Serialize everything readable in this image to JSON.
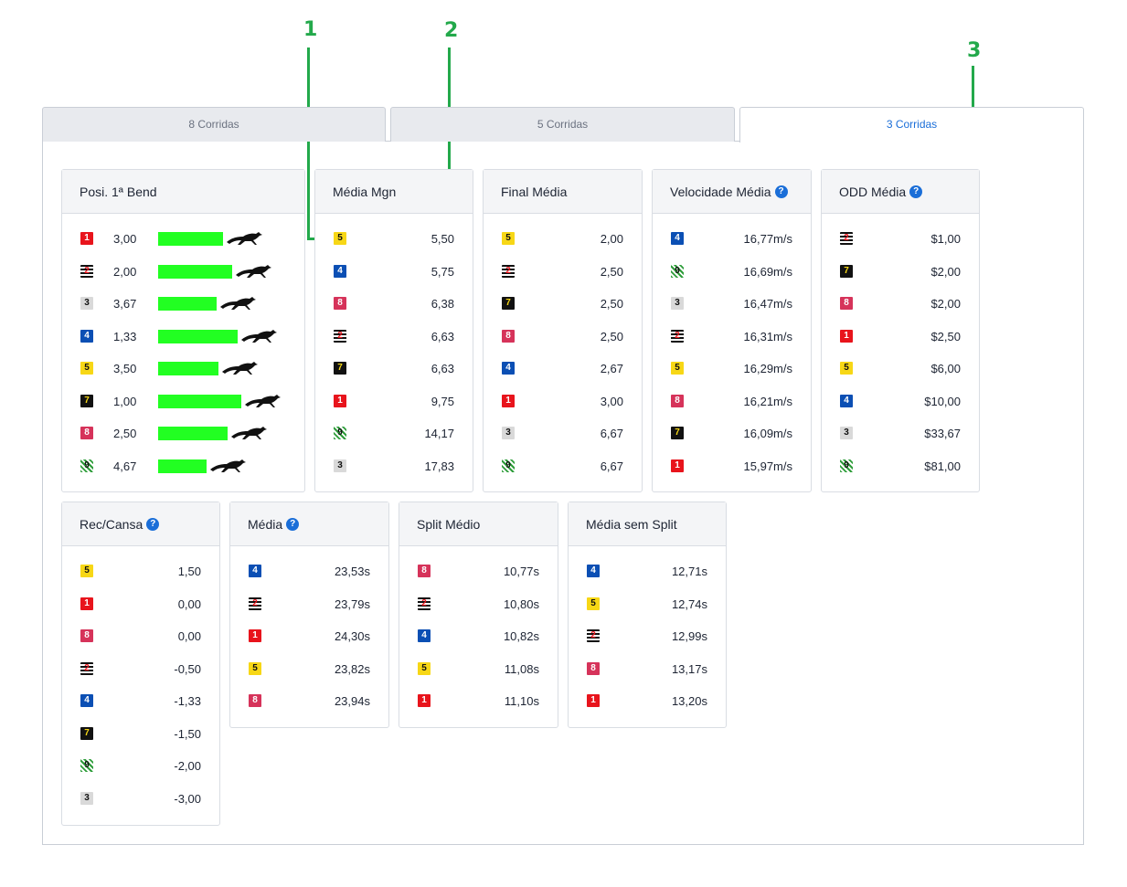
{
  "annotations": [
    "1",
    "2",
    "3"
  ],
  "tabs": [
    {
      "label": "8 Corridas"
    },
    {
      "label": "5 Corridas"
    },
    {
      "label": "3 Corridas",
      "active": true
    }
  ],
  "trap_colors": {
    "1": "#e8141c",
    "2": "#111111",
    "3": "#d9d9d9",
    "4": "#0b4fb4",
    "5": "#f7d716",
    "7": "#111111",
    "8": "#d6335a",
    "9": "#2e9d3a"
  },
  "bar_color": "#22ff22",
  "cards": {
    "posi_bend": {
      "title": "Posi. 1ª Bend",
      "rows": [
        {
          "trap": "1",
          "value": "3,00",
          "bar_fraction": 0.6
        },
        {
          "trap": "2",
          "value": "2,00",
          "bar_fraction": 0.69
        },
        {
          "trap": "3",
          "value": "3,67",
          "bar_fraction": 0.54
        },
        {
          "trap": "4",
          "value": "1,33",
          "bar_fraction": 0.74
        },
        {
          "trap": "5",
          "value": "3,50",
          "bar_fraction": 0.56
        },
        {
          "trap": "7",
          "value": "1,00",
          "bar_fraction": 0.77
        },
        {
          "trap": "8",
          "value": "2,50",
          "bar_fraction": 0.64
        },
        {
          "trap": "9",
          "value": "4,67",
          "bar_fraction": 0.45
        }
      ]
    },
    "media_mgn": {
      "title": "Média Mgn",
      "rows": [
        {
          "trap": "5",
          "value": "5,50"
        },
        {
          "trap": "4",
          "value": "5,75"
        },
        {
          "trap": "8",
          "value": "6,38"
        },
        {
          "trap": "2",
          "value": "6,63"
        },
        {
          "trap": "7",
          "value": "6,63"
        },
        {
          "trap": "1",
          "value": "9,75"
        },
        {
          "trap": "9",
          "value": "14,17"
        },
        {
          "trap": "3",
          "value": "17,83"
        }
      ]
    },
    "final_media": {
      "title": "Final Média",
      "rows": [
        {
          "trap": "5",
          "value": "2,00"
        },
        {
          "trap": "2",
          "value": "2,50"
        },
        {
          "trap": "7",
          "value": "2,50"
        },
        {
          "trap": "8",
          "value": "2,50"
        },
        {
          "trap": "4",
          "value": "2,67"
        },
        {
          "trap": "1",
          "value": "3,00"
        },
        {
          "trap": "3",
          "value": "6,67"
        },
        {
          "trap": "9",
          "value": "6,67"
        }
      ]
    },
    "velocidade_media": {
      "title": "Velocidade Média",
      "help": "?",
      "rows": [
        {
          "trap": "4",
          "value": "16,77m/s"
        },
        {
          "trap": "9",
          "value": "16,69m/s"
        },
        {
          "trap": "3",
          "value": "16,47m/s"
        },
        {
          "trap": "2",
          "value": "16,31m/s"
        },
        {
          "trap": "5",
          "value": "16,29m/s"
        },
        {
          "trap": "8",
          "value": "16,21m/s"
        },
        {
          "trap": "7",
          "value": "16,09m/s"
        },
        {
          "trap": "1",
          "value": "15,97m/s"
        }
      ]
    },
    "odd_media": {
      "title": "ODD Média",
      "help": "?",
      "rows": [
        {
          "trap": "2",
          "value": "$1,00"
        },
        {
          "trap": "7",
          "value": "$2,00"
        },
        {
          "trap": "8",
          "value": "$2,00"
        },
        {
          "trap": "1",
          "value": "$2,50"
        },
        {
          "trap": "5",
          "value": "$6,00"
        },
        {
          "trap": "4",
          "value": "$10,00"
        },
        {
          "trap": "3",
          "value": "$33,67"
        },
        {
          "trap": "9",
          "value": "$81,00"
        }
      ]
    },
    "rec_cansa": {
      "title": "Rec/Cansa",
      "help": "?",
      "rows": [
        {
          "trap": "5",
          "value": "1,50"
        },
        {
          "trap": "1",
          "value": "0,00"
        },
        {
          "trap": "8",
          "value": "0,00"
        },
        {
          "trap": "2",
          "value": "-0,50"
        },
        {
          "trap": "4",
          "value": "-1,33"
        },
        {
          "trap": "7",
          "value": "-1,50"
        },
        {
          "trap": "9",
          "value": "-2,00"
        },
        {
          "trap": "3",
          "value": "-3,00"
        }
      ]
    },
    "media": {
      "title": "Média",
      "help": "?",
      "rows": [
        {
          "trap": "4",
          "value": "23,53s"
        },
        {
          "trap": "2",
          "value": "23,79s"
        },
        {
          "trap": "1",
          "value": "24,30s"
        },
        {
          "trap": "5",
          "value": "23,82s"
        },
        {
          "trap": "8",
          "value": "23,94s"
        }
      ]
    },
    "split_medio": {
      "title": "Split Médio",
      "rows": [
        {
          "trap": "8",
          "value": "10,77s"
        },
        {
          "trap": "2",
          "value": "10,80s"
        },
        {
          "trap": "4",
          "value": "10,82s"
        },
        {
          "trap": "5",
          "value": "11,08s"
        },
        {
          "trap": "1",
          "value": "11,10s"
        }
      ]
    },
    "media_sem_split": {
      "title": "Média sem Split",
      "rows": [
        {
          "trap": "4",
          "value": "12,71s"
        },
        {
          "trap": "5",
          "value": "12,74s"
        },
        {
          "trap": "2",
          "value": "12,99s"
        },
        {
          "trap": "8",
          "value": "13,17s"
        },
        {
          "trap": "1",
          "value": "13,20s"
        }
      ]
    }
  }
}
